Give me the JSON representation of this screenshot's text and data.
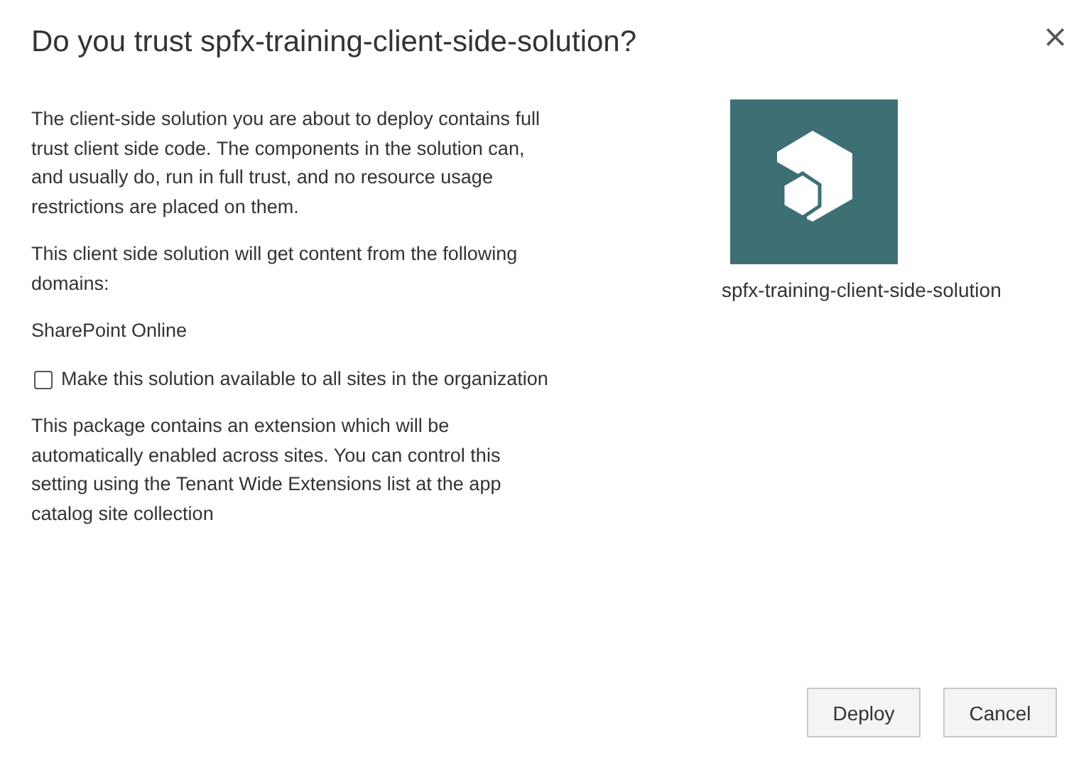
{
  "dialog": {
    "title": "Do you trust spfx-training-client-side-solution?",
    "close": "×",
    "paragraphs": [
      "The client-side solution you are about to deploy contains full trust client side code. The components in the solution can, and usually do, run in full trust, and no resource usage restrictions are placed on them.",
      "This client side solution will get content from the following domains:",
      "SharePoint Online"
    ],
    "checkbox": {
      "label": "Make this solution available to all sites in the organization",
      "checked": false
    },
    "note": "This package contains an extension which will be automatically enabled across sites. You can control this setting using the Tenant Wide Extensions list at the app catalog site collection",
    "app": {
      "name": "spfx-training-client-side-solution"
    },
    "buttons": [
      "Deploy",
      "Cancel"
    ]
  }
}
